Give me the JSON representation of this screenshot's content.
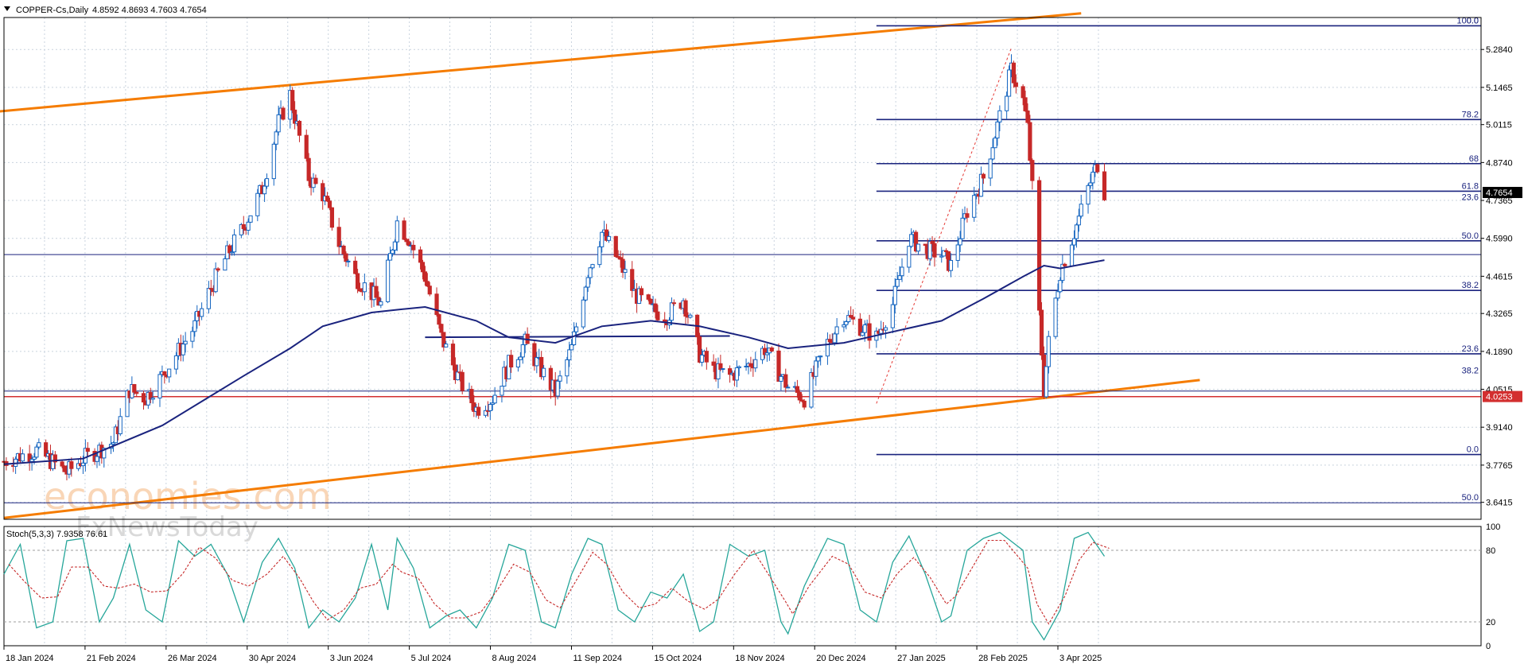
{
  "header": {
    "symbol_label": "COPPER-Cs,Daily",
    "ohlc": "4.8592 4.8693 4.7603 4.7654",
    "dropdown_icon": "triangle-down-icon"
  },
  "watermark": {
    "brand": "economies.com",
    "sub": "FxNewsToday"
  },
  "colors": {
    "up_candle": "#ffffff",
    "down_candle": "#c62828",
    "candle_outline": "#1565c0",
    "ma": "#1a237e",
    "channel": "#f57c00",
    "fib": "#1a237e",
    "support": "#d32f2f",
    "stoch_main": "#26a69a",
    "stoch_signal": "#c62828",
    "grid": "#c9d3de"
  },
  "chart_data": {
    "type": "candlestick",
    "title": "COPPER-Cs,Daily",
    "ylim": [
      3.58,
      5.4
    ],
    "y_ticks": [
      "5.2840",
      "5.1465",
      "5.0115",
      "4.8740",
      "4.7365",
      "4.5990",
      "4.4615",
      "4.3265",
      "4.1890",
      "4.0515",
      "3.9140",
      "3.7765",
      "3.6415"
    ],
    "x_ticks": [
      "18 Jan 2024",
      "21 Feb 2024",
      "26 Mar 2024",
      "30 Apr 2024",
      "3 Jun 2024",
      "5 Jul 2024",
      "8 Aug 2024",
      "11 Sep 2024",
      "15 Oct 2024",
      "18 Nov 2024",
      "20 Dec 2024",
      "27 Jan 2025",
      "28 Feb 2025",
      "3 Apr 2025"
    ],
    "current_price": "4.7654",
    "support_price": "4.0253",
    "price_path": [
      [
        "2024-01-18",
        3.79
      ],
      [
        "2024-02-01",
        3.83
      ],
      [
        "2024-02-14",
        3.75
      ],
      [
        "2024-02-21",
        3.8
      ],
      [
        "2024-03-05",
        3.86
      ],
      [
        "2024-03-12",
        4.05
      ],
      [
        "2024-03-19",
        4.02
      ],
      [
        "2024-03-26",
        4.1
      ],
      [
        "2024-04-09",
        4.28
      ],
      [
        "2024-04-16",
        4.42
      ],
      [
        "2024-04-23",
        4.54
      ],
      [
        "2024-04-30",
        4.64
      ],
      [
        "2024-05-08",
        4.78
      ],
      [
        "2024-05-15",
        5.02
      ],
      [
        "2024-05-20",
        5.12
      ],
      [
        "2024-05-22",
        5.04
      ],
      [
        "2024-05-28",
        4.82
      ],
      [
        "2024-06-03",
        4.76
      ],
      [
        "2024-06-10",
        4.58
      ],
      [
        "2024-06-17",
        4.46
      ],
      [
        "2024-06-24",
        4.4
      ],
      [
        "2024-06-28",
        4.36
      ],
      [
        "2024-07-05",
        4.66
      ],
      [
        "2024-07-10",
        4.6
      ],
      [
        "2024-07-17",
        4.46
      ],
      [
        "2024-07-24",
        4.24
      ],
      [
        "2024-08-01",
        4.08
      ],
      [
        "2024-08-08",
        3.98
      ],
      [
        "2024-08-15",
        4.02
      ],
      [
        "2024-08-22",
        4.14
      ],
      [
        "2024-08-29",
        4.22
      ],
      [
        "2024-09-05",
        4.12
      ],
      [
        "2024-09-11",
        4.04
      ],
      [
        "2024-09-18",
        4.2
      ],
      [
        "2024-09-25",
        4.48
      ],
      [
        "2024-10-01",
        4.62
      ],
      [
        "2024-10-08",
        4.52
      ],
      [
        "2024-10-15",
        4.4
      ],
      [
        "2024-10-22",
        4.34
      ],
      [
        "2024-10-29",
        4.32
      ],
      [
        "2024-11-05",
        4.38
      ],
      [
        "2024-11-12",
        4.18
      ],
      [
        "2024-11-18",
        4.12
      ],
      [
        "2024-11-25",
        4.1
      ],
      [
        "2024-12-03",
        4.14
      ],
      [
        "2024-12-10",
        4.2
      ],
      [
        "2024-12-17",
        4.1
      ],
      [
        "2024-12-20",
        4.06
      ],
      [
        "2024-12-27",
        4.02
      ],
      [
        "2025-01-06",
        4.22
      ],
      [
        "2025-01-13",
        4.32
      ],
      [
        "2025-01-20",
        4.28
      ],
      [
        "2025-01-27",
        4.24
      ],
      [
        "2025-02-03",
        4.36
      ],
      [
        "2025-02-10",
        4.6
      ],
      [
        "2025-02-17",
        4.56
      ],
      [
        "2025-02-24",
        4.54
      ],
      [
        "2025-02-28",
        4.5
      ],
      [
        "2025-03-07",
        4.7
      ],
      [
        "2025-03-14",
        4.82
      ],
      [
        "2025-03-21",
        5.04
      ],
      [
        "2025-03-26",
        5.21
      ],
      [
        "2025-03-31",
        5.1
      ],
      [
        "2025-04-02",
        5.0
      ],
      [
        "2025-04-04",
        4.78
      ],
      [
        "2025-04-07",
        4.32
      ],
      [
        "2025-04-09",
        4.05
      ],
      [
        "2025-04-11",
        4.22
      ],
      [
        "2025-04-16",
        4.48
      ],
      [
        "2025-04-22",
        4.62
      ],
      [
        "2025-04-28",
        4.78
      ],
      [
        "2025-05-02",
        4.87
      ],
      [
        "2025-05-05",
        4.77
      ]
    ],
    "moving_average": [
      [
        "2024-01-18",
        3.78
      ],
      [
        "2024-02-21",
        3.8
      ],
      [
        "2024-03-26",
        3.92
      ],
      [
        "2024-04-30",
        4.1
      ],
      [
        "2024-05-20",
        4.2
      ],
      [
        "2024-06-03",
        4.28
      ],
      [
        "2024-06-24",
        4.33
      ],
      [
        "2024-07-05",
        4.34
      ],
      [
        "2024-07-17",
        4.35
      ],
      [
        "2024-08-08",
        4.3
      ],
      [
        "2024-08-22",
        4.24
      ],
      [
        "2024-09-11",
        4.22
      ],
      [
        "2024-10-01",
        4.28
      ],
      [
        "2024-10-22",
        4.3
      ],
      [
        "2024-11-12",
        4.28
      ],
      [
        "2024-12-03",
        4.24
      ],
      [
        "2024-12-20",
        4.2
      ],
      [
        "2025-01-13",
        4.22
      ],
      [
        "2025-02-03",
        4.26
      ],
      [
        "2025-02-24",
        4.3
      ],
      [
        "2025-03-14",
        4.38
      ],
      [
        "2025-03-31",
        4.46
      ],
      [
        "2025-04-09",
        4.5
      ],
      [
        "2025-04-16",
        4.49
      ],
      [
        "2025-05-05",
        4.52
      ]
    ],
    "channel_upper": [
      [
        "2024-01-10",
        5.055
      ],
      [
        "2025-04-25",
        5.415
      ]
    ],
    "channel_lower": [
      [
        "2024-01-18",
        3.585
      ],
      [
        "2025-06-15",
        4.085
      ]
    ],
    "horizontal_lines": [
      {
        "name": "support",
        "price": 4.025,
        "label": "4.0253"
      },
      {
        "name": "upper-range",
        "price": 4.54
      },
      {
        "name": "lower-range",
        "price": 3.64
      },
      {
        "name": "mid-range",
        "price": 4.045
      }
    ],
    "range_line": {
      "from": [
        "2024-07-17",
        4.24
      ],
      "to": [
        "2024-11-25",
        4.245
      ]
    },
    "fib_retracement_lower": [
      {
        "label": "100.0",
        "price": 5.37
      },
      {
        "label": "78.2",
        "price": 5.03
      },
      {
        "label": "68",
        "price": 4.87
      },
      {
        "label": "61.8",
        "price": 4.77
      },
      {
        "label": "50.0",
        "price": 4.59
      },
      {
        "label": "38.2",
        "price": 4.41
      },
      {
        "label": "23.6",
        "price": 4.18
      },
      {
        "label": "0.0",
        "price": 3.815
      }
    ],
    "fib_retracement_upper": [
      {
        "label": "0.0",
        "price": 5.37
      },
      {
        "label": "23.6",
        "price": 4.73
      },
      {
        "label": "38.2",
        "price": 4.1
      },
      {
        "label": "50.0",
        "price": 3.64
      }
    ],
    "fib_start_date": "2025-01-27",
    "fib_trend": {
      "from": [
        "2025-01-27",
        4.0
      ],
      "to": [
        "2025-03-26",
        5.29
      ]
    },
    "stochastic": {
      "label": "Stoch(5,3,3) 7.9358 76.61",
      "levels": [
        100,
        80,
        20,
        0
      ],
      "main": [
        [
          "2024-01-18",
          60
        ],
        [
          "2024-01-25",
          85
        ],
        [
          "2024-02-01",
          15
        ],
        [
          "2024-02-08",
          20
        ],
        [
          "2024-02-14",
          88
        ],
        [
          "2024-02-21",
          90
        ],
        [
          "2024-02-28",
          20
        ],
        [
          "2024-03-05",
          40
        ],
        [
          "2024-03-12",
          85
        ],
        [
          "2024-03-19",
          30
        ],
        [
          "2024-03-26",
          20
        ],
        [
          "2024-04-02",
          88
        ],
        [
          "2024-04-09",
          75
        ],
        [
          "2024-04-16",
          85
        ],
        [
          "2024-04-23",
          60
        ],
        [
          "2024-04-30",
          20
        ],
        [
          "2024-05-08",
          70
        ],
        [
          "2024-05-15",
          90
        ],
        [
          "2024-05-22",
          65
        ],
        [
          "2024-05-28",
          15
        ],
        [
          "2024-06-03",
          30
        ],
        [
          "2024-06-10",
          20
        ],
        [
          "2024-06-17",
          40
        ],
        [
          "2024-06-24",
          85
        ],
        [
          "2024-07-01",
          30
        ],
        [
          "2024-07-05",
          90
        ],
        [
          "2024-07-12",
          65
        ],
        [
          "2024-07-19",
          15
        ],
        [
          "2024-07-26",
          25
        ],
        [
          "2024-08-01",
          30
        ],
        [
          "2024-08-08",
          15
        ],
        [
          "2024-08-15",
          40
        ],
        [
          "2024-08-22",
          85
        ],
        [
          "2024-08-29",
          80
        ],
        [
          "2024-09-05",
          20
        ],
        [
          "2024-09-11",
          15
        ],
        [
          "2024-09-18",
          60
        ],
        [
          "2024-09-25",
          90
        ],
        [
          "2024-10-01",
          85
        ],
        [
          "2024-10-08",
          30
        ],
        [
          "2024-10-15",
          20
        ],
        [
          "2024-10-22",
          45
        ],
        [
          "2024-10-29",
          40
        ],
        [
          "2024-11-05",
          60
        ],
        [
          "2024-11-12",
          12
        ],
        [
          "2024-11-18",
          20
        ],
        [
          "2024-11-25",
          85
        ],
        [
          "2024-12-03",
          75
        ],
        [
          "2024-12-10",
          80
        ],
        [
          "2024-12-17",
          20
        ],
        [
          "2024-12-20",
          10
        ],
        [
          "2024-12-27",
          50
        ],
        [
          "2025-01-06",
          90
        ],
        [
          "2025-01-13",
          85
        ],
        [
          "2025-01-20",
          30
        ],
        [
          "2025-01-27",
          20
        ],
        [
          "2025-02-03",
          70
        ],
        [
          "2025-02-10",
          92
        ],
        [
          "2025-02-17",
          60
        ],
        [
          "2025-02-24",
          20
        ],
        [
          "2025-02-28",
          25
        ],
        [
          "2025-03-07",
          80
        ],
        [
          "2025-03-14",
          90
        ],
        [
          "2025-03-21",
          95
        ],
        [
          "2025-03-31",
          80
        ],
        [
          "2025-04-04",
          20
        ],
        [
          "2025-04-09",
          5
        ],
        [
          "2025-04-16",
          30
        ],
        [
          "2025-04-22",
          90
        ],
        [
          "2025-04-28",
          95
        ],
        [
          "2025-05-05",
          75
        ]
      ]
    }
  }
}
